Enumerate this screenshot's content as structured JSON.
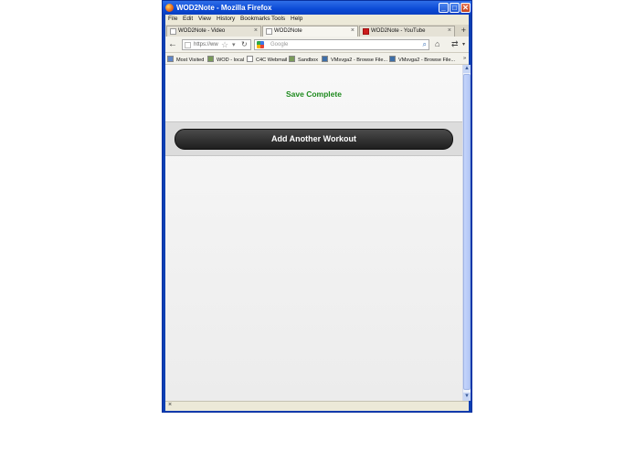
{
  "window": {
    "title": "WOD2Note - Mozilla Firefox",
    "buttons": {
      "minimize": "_",
      "maximize": "□",
      "close": "✕"
    }
  },
  "menu": [
    "File",
    "Edit",
    "View",
    "History",
    "Bookmarks",
    "Tools",
    "Help"
  ],
  "tabs": [
    {
      "label": "WOD2Note - Video",
      "close": "×"
    },
    {
      "label": "WOD2Note",
      "close": "×",
      "active": true
    },
    {
      "label": "WOD2Note - YouTube",
      "close": "×"
    }
  ],
  "new_tab": "+",
  "navbar": {
    "back": "←",
    "url": "https://ww",
    "search_placeholder": "Google"
  },
  "bookmarks": [
    "Most Visited",
    "WOD - local",
    "C4C Webmail",
    "Sandbox",
    "VMsvga2 - Browse File...",
    "VMsvga2 - Browse File..."
  ],
  "bookmarks_overflow": "»",
  "page": {
    "status": "Save Complete",
    "add_button": "Add Another Workout",
    "status_color": "#1e8a1e"
  },
  "findbar": {
    "close": "×"
  }
}
